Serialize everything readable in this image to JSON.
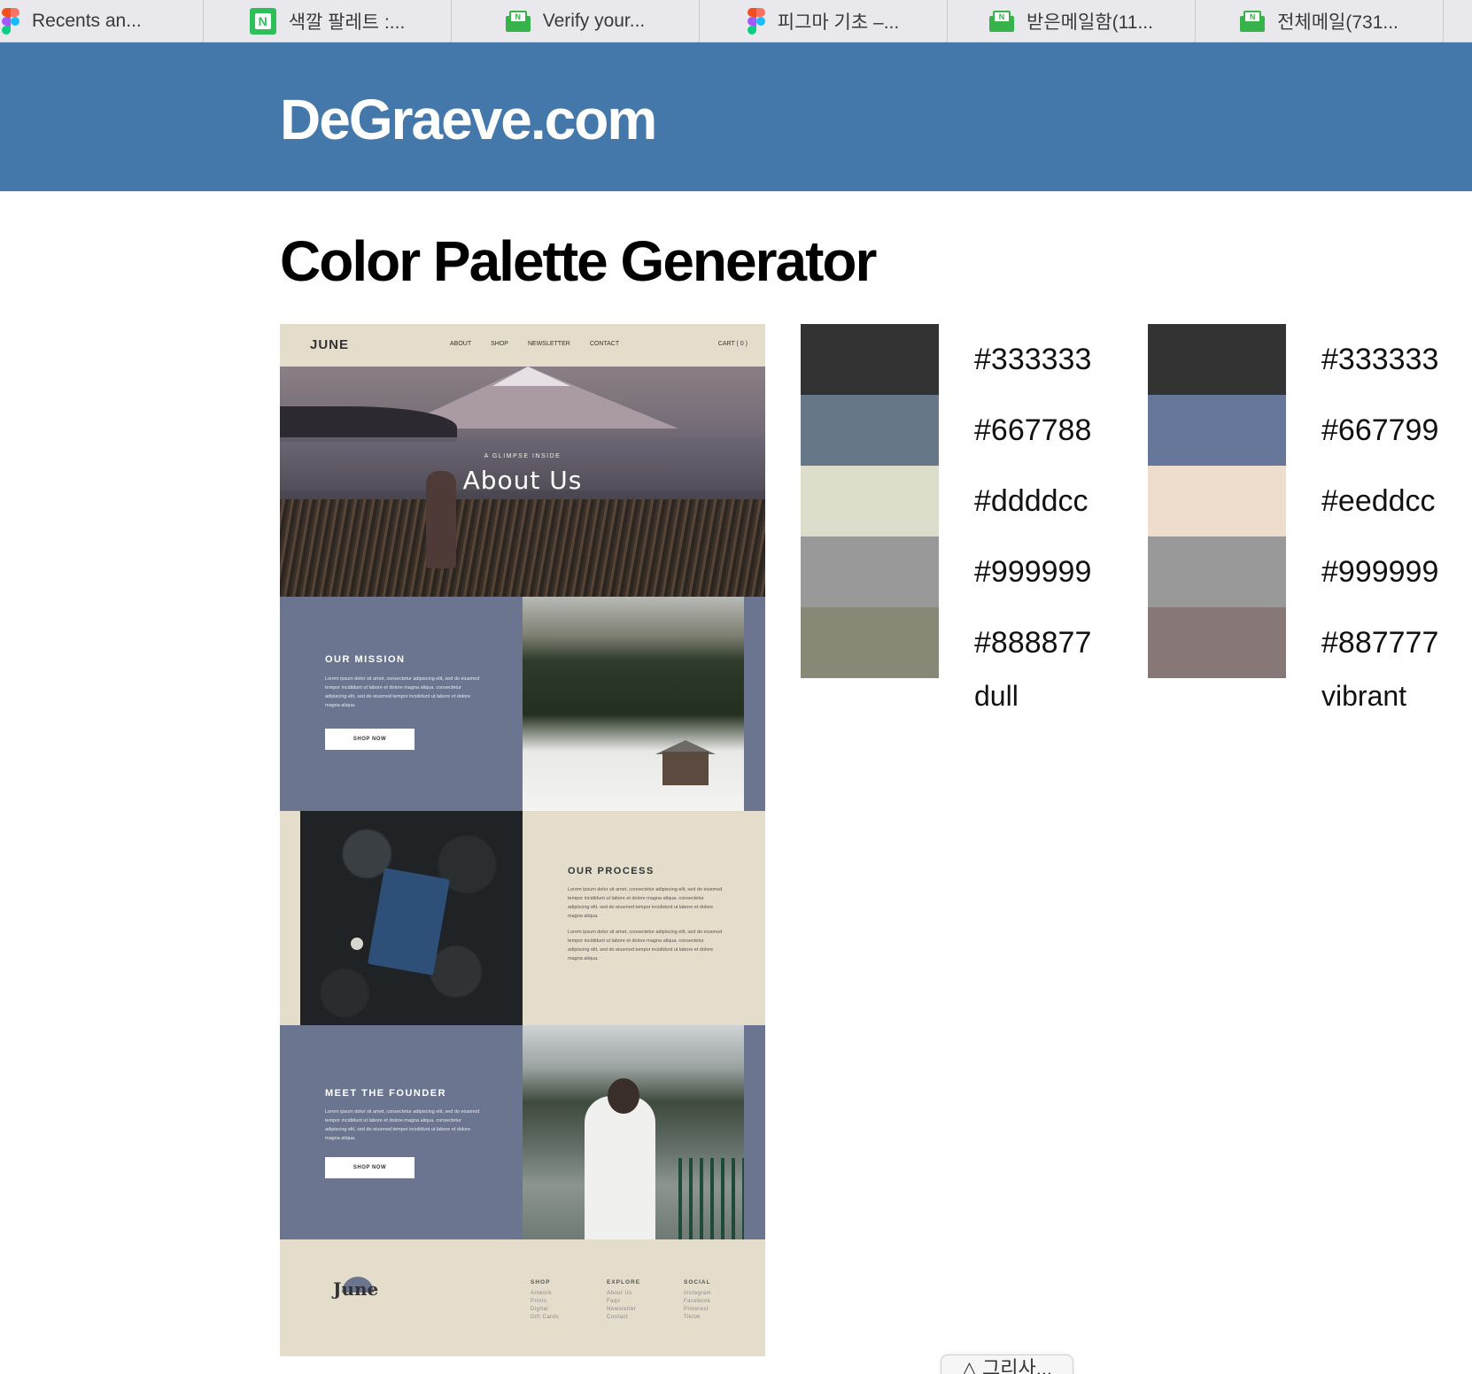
{
  "tabs": [
    {
      "label": "Recents an...",
      "icon": "figma-icon"
    },
    {
      "label": "색깔 팔레트 :...",
      "icon": "naver-n-icon"
    },
    {
      "label": "Verify your...",
      "icon": "naver-mail-icon"
    },
    {
      "label": "피그마 기초 –...",
      "icon": "figma-icon"
    },
    {
      "label": "받은메일함(11...",
      "icon": "naver-mail-icon"
    },
    {
      "label": "전체메일(731...",
      "icon": "naver-mail-icon"
    }
  ],
  "header": {
    "site_title": "DeGraeve.com",
    "background": "#4477aa"
  },
  "page": {
    "title": "Color Palette Generator"
  },
  "mockup": {
    "nav": {
      "logo": "JUNE",
      "links": [
        "ABOUT",
        "SHOP",
        "NEWSLETTER",
        "CONTACT"
      ],
      "cart": "CART ( 0 )"
    },
    "hero": {
      "eyebrow": "A GLIMPSE INSIDE",
      "title": "About Us"
    },
    "mission": {
      "heading": "OUR MISSION",
      "body": "Lorem ipsum dolor sit amet, consectetur adipiscing elit, sed do eiusmod tempor incididunt ut labore et dolore magna aliqua. consectetur adipiscing elit, sed do eiusmod tempor incididunt ut labore et dolore magna aliqua.",
      "button": "SHOP NOW"
    },
    "process": {
      "heading": "OUR PROCESS",
      "body1": "Lorem ipsum dolor sit amet, consectetur adipiscing elit, sed do eiusmod tempor incididunt ut labore et dolore magna aliqua. consectetur adipiscing elit, sed do eiusmod tempor incididunt ut labore et dolore magna aliqua.",
      "body2": "Lorem ipsum dolor sit amet, consectetur adipiscing elit, sed do eiusmod tempor incididunt ut labore et dolore magna aliqua. consectetur adipiscing elit, sed do eiusmod tempor incididunt ut labore et dolore magna aliqua."
    },
    "founder": {
      "heading": "MEET THE FOUNDER",
      "body": "Lorem ipsum dolor sit amet, consectetur adipiscing elit, sed do eiusmod tempor incididunt ut labore et dolore magna aliqua. consectetur adipiscing elit, sed do eiusmod tempor incididunt ut labore et dolore magna aliqua.",
      "button": "SHOP NOW"
    },
    "footer": {
      "logo": "June",
      "columns": [
        {
          "title": "SHOP",
          "items": [
            "Artwork",
            "Prints",
            "Digital",
            "Gift Cards"
          ]
        },
        {
          "title": "EXPLORE",
          "items": [
            "About Us",
            "Faqs",
            "Newsletter",
            "Contact"
          ]
        },
        {
          "title": "SOCIAL",
          "items": [
            "Instagram",
            "Facebook",
            "Pinterest",
            "Tiktok"
          ]
        }
      ]
    }
  },
  "palettes": [
    {
      "label": "dull",
      "colors": [
        "#333333",
        "#667788",
        "#ddddcc",
        "#999999",
        "#888877"
      ]
    },
    {
      "label": "vibrant",
      "colors": [
        "#333333",
        "#667799",
        "#eeddcc",
        "#999999",
        "#887777"
      ]
    }
  ],
  "floating_button": {
    "label": "△ 그리사..."
  }
}
